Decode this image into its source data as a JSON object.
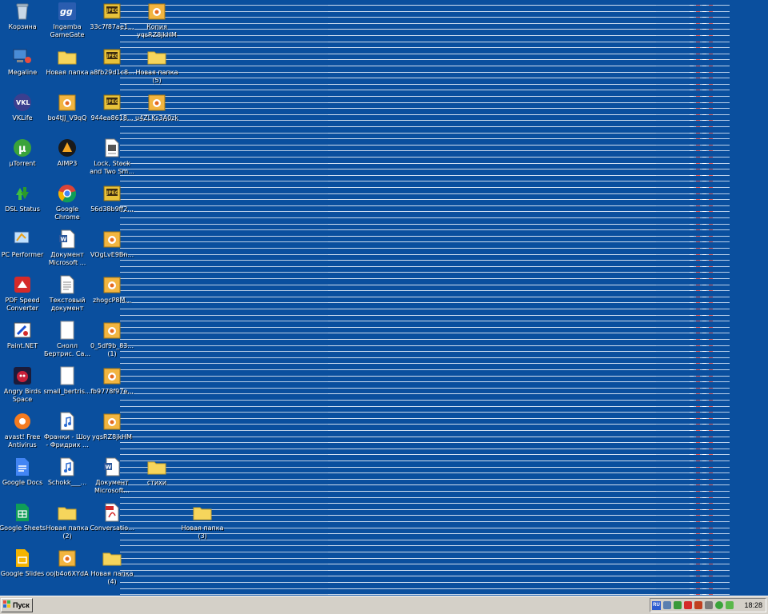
{
  "desktop": {
    "icons": [
      {
        "label": "Корзина",
        "icon": "recycle-bin-icon"
      },
      {
        "label": "Megaline",
        "icon": "megaline-icon"
      },
      {
        "label": "VKLife",
        "icon": "vklife-icon"
      },
      {
        "label": "µTorrent",
        "icon": "utorrent-icon"
      },
      {
        "label": "DSL Status",
        "icon": "dsl-status-icon"
      },
      {
        "label": "PC Performer",
        "icon": "pc-performer-icon"
      },
      {
        "label": "PDF Speed Converter",
        "icon": "pdf-converter-icon"
      },
      {
        "label": "Paint.NET",
        "icon": "paint-net-icon"
      },
      {
        "label": "Angry Birds Space",
        "icon": "angry-birds-icon"
      },
      {
        "label": "avast! Free Antivirus",
        "icon": "avast-icon"
      },
      {
        "label": "Google Docs",
        "icon": "google-docs-icon"
      },
      {
        "label": "Google Sheets",
        "icon": "google-sheets-icon"
      },
      {
        "label": "Google Slides",
        "icon": "google-slides-icon"
      },
      {
        "label": "Ingamba GameGate",
        "icon": "gamegate-icon"
      },
      {
        "label": "Новая папка",
        "icon": "folder-icon"
      },
      {
        "label": "bo4tJJ_V9qQ",
        "icon": "image-file-icon"
      },
      {
        "label": "AIMP3",
        "icon": "aimp-icon"
      },
      {
        "label": "Google Chrome",
        "icon": "chrome-icon"
      },
      {
        "label": "Документ Microsoft ...",
        "icon": "word-doc-icon"
      },
      {
        "label": "Текстовый документ",
        "icon": "text-file-icon"
      },
      {
        "label": "Снолл Бертрис. Са...",
        "icon": "blank-doc-icon"
      },
      {
        "label": "small_bertris...",
        "icon": "blank-doc-icon"
      },
      {
        "label": "Франки - Шоу - Фридрих ...",
        "icon": "audio-file-icon"
      },
      {
        "label": "Schokk___...",
        "icon": "audio-file-icon"
      },
      {
        "label": "Новая папка (2)",
        "icon": "folder-icon"
      },
      {
        "label": "oojb4o6XYdA",
        "icon": "image-file-icon"
      },
      {
        "label": "33c7f87ae1...",
        "icon": "jpeg-file-icon"
      },
      {
        "label": "a8fb29d1c8...",
        "icon": "jpeg-file-icon"
      },
      {
        "label": "944ea8618...",
        "icon": "jpeg-file-icon"
      },
      {
        "label": "Lock, Stock and Two Sm...",
        "icon": "text-file-icon"
      },
      {
        "label": "56d38b9ff2...",
        "icon": "jpeg-file-icon"
      },
      {
        "label": "VOgLvE9Bn...",
        "icon": "image-file-icon"
      },
      {
        "label": "zhogcP8M...",
        "icon": "image-file-icon"
      },
      {
        "label": "0_5df9b_83... (1)",
        "icon": "image-file-icon"
      },
      {
        "label": "fb9778f97e...",
        "icon": "image-file-icon"
      },
      {
        "label": "yqsRZ8jkHM",
        "icon": "image-file-icon"
      },
      {
        "label": "Документ Microsoft...",
        "icon": "word-doc-icon"
      },
      {
        "label": "Conversatio...",
        "icon": "pdf-file-icon"
      },
      {
        "label": "Новая папка (4)",
        "icon": "folder-icon"
      },
      {
        "label": "Копия yqsRZ8jkHM",
        "icon": "image-file-icon"
      },
      {
        "label": "Новая папка (5)",
        "icon": "folder-icon"
      },
      {
        "label": "u4ZLKs3A0zk",
        "icon": "image-file-icon"
      },
      {
        "label": "стихи",
        "icon": "folder-icon"
      },
      {
        "label": "Новая папка (3)",
        "icon": "folder-icon"
      }
    ]
  },
  "taskbar": {
    "start_label": "Пуск",
    "start_icon": "windows-logo-icon",
    "tray_icons": [
      "language-indicator-icon",
      "network-icon",
      "monitor-icon",
      "security-alert-icon",
      "volume-icon",
      "shield-icon",
      "utorrent-tray-icon",
      "antivirus-tray-icon"
    ],
    "clock": "18:28",
    "language": "RU"
  },
  "colors": {
    "desktop": "#0a4f9e",
    "taskbar": "#d4d0c8",
    "folder": "#f6d55c",
    "jpeg": "#e8c23a"
  }
}
